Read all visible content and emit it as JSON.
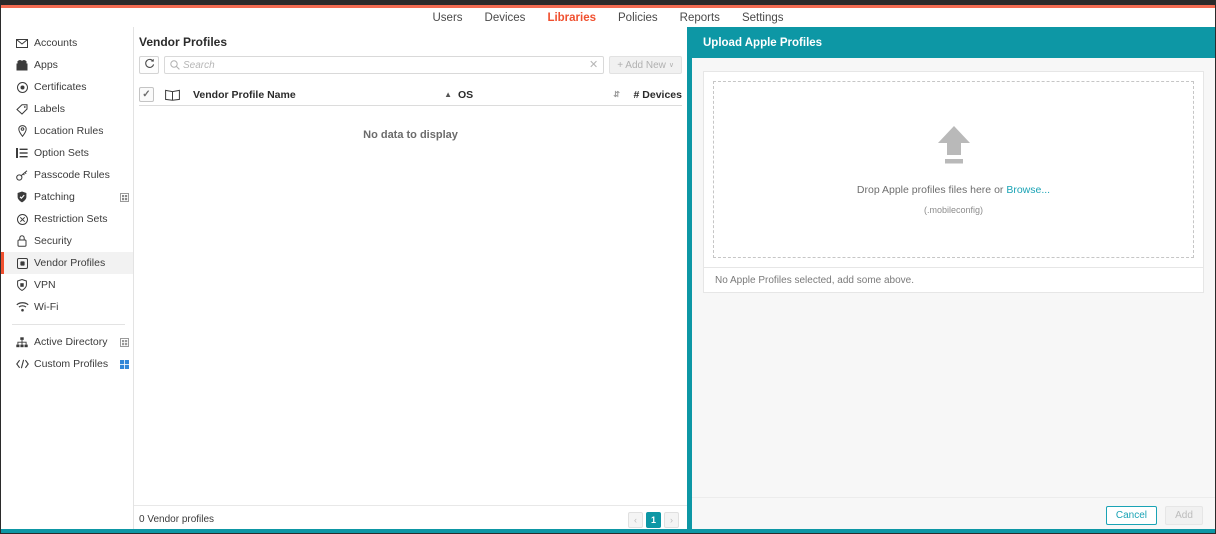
{
  "topnav": {
    "items": [
      {
        "label": "Users",
        "active": false
      },
      {
        "label": "Devices",
        "active": false
      },
      {
        "label": "Libraries",
        "active": true
      },
      {
        "label": "Policies",
        "active": false
      },
      {
        "label": "Reports",
        "active": false
      },
      {
        "label": "Settings",
        "active": false
      }
    ],
    "accent_color": "#f0502f"
  },
  "sidebar": {
    "items": [
      {
        "label": "Accounts",
        "icon": "envelope-icon",
        "badge": null
      },
      {
        "label": "Apps",
        "icon": "app-box-icon",
        "badge": null
      },
      {
        "label": "Certificates",
        "icon": "certificate-icon",
        "badge": null
      },
      {
        "label": "Labels",
        "icon": "tag-icon",
        "badge": null
      },
      {
        "label": "Location Rules",
        "icon": "location-pin-icon",
        "badge": null
      },
      {
        "label": "Option Sets",
        "icon": "option-sets-icon",
        "badge": null
      },
      {
        "label": "Passcode Rules",
        "icon": "passcode-key-icon",
        "badge": null
      },
      {
        "label": "Patching",
        "icon": "shield-icon",
        "badge": "patching-badge-icon"
      },
      {
        "label": "Restriction Sets",
        "icon": "restriction-icon",
        "badge": null
      },
      {
        "label": "Security",
        "icon": "lock-icon",
        "badge": null
      },
      {
        "label": "Vendor Profiles",
        "icon": "vendor-profile-icon",
        "badge": null
      },
      {
        "label": "VPN",
        "icon": "vpn-shield-icon",
        "badge": null
      },
      {
        "label": "Wi-Fi",
        "icon": "wifi-icon",
        "badge": null
      }
    ],
    "items_secondary": [
      {
        "label": "Active Directory",
        "icon": "sitemap-icon",
        "badge": "windows-gray-badge-icon"
      },
      {
        "label": "Custom Profiles",
        "icon": "code-icon",
        "badge": "windows-blue-badge-icon"
      }
    ],
    "active_label": "Vendor Profiles",
    "active_border_color": "#f0502f"
  },
  "main": {
    "title": "Vendor Profiles",
    "toolbar": {
      "refresh_icon": "refresh-icon",
      "search_placeholder": "Search",
      "search_value": "",
      "search_icon": "search-icon",
      "clear_icon": "clear-icon",
      "add_new_label": "+ Add New",
      "add_new_caret": "∨",
      "add_new_disabled": true
    },
    "table": {
      "select_all_checked": true,
      "row_icon": "book-icon",
      "columns": [
        {
          "label": "Vendor Profile Name",
          "sort": "asc"
        },
        {
          "label": "OS",
          "sort": "none"
        },
        {
          "label": "# Devices",
          "sort": null
        }
      ],
      "rows": [],
      "empty_message": "No data to display"
    },
    "footer": {
      "count_text": "0 Vendor profiles",
      "pager": {
        "prev": "‹",
        "pages": [
          "1"
        ],
        "current": "1",
        "next": "›"
      }
    }
  },
  "panel": {
    "title": "Upload Apple Profiles",
    "header_color": "#0d97a5",
    "dropzone": {
      "icon": "upload-arrow-icon",
      "text_before": "Drop Apple profiles files here or ",
      "browse_label": "Browse...",
      "file_types": "(.mobileconfig)"
    },
    "status_note": "No Apple Profiles selected, add some above.",
    "footer": {
      "cancel_label": "Cancel",
      "add_label": "Add",
      "add_disabled": true
    }
  }
}
